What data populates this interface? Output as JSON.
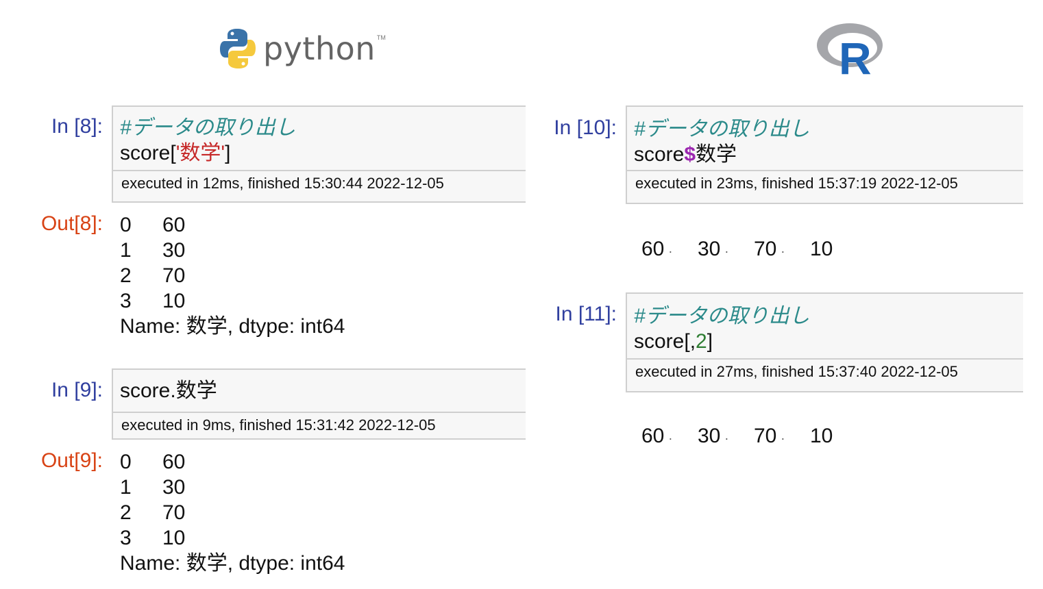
{
  "logos": {
    "python_word": "python",
    "python_tm": "TM",
    "r_letter": "R"
  },
  "left": {
    "cell1": {
      "prompt_in": "In [8]:",
      "comment": "#データの取り出し",
      "code_prefix": "score[",
      "code_string": "'数学'",
      "code_suffix": "]",
      "exec": "executed in 12ms, finished 15:30:44 2022-12-05",
      "prompt_out": "Out[8]:",
      "rows": [
        [
          "0",
          "60"
        ],
        [
          "1",
          "30"
        ],
        [
          "2",
          "70"
        ],
        [
          "3",
          "10"
        ]
      ],
      "footer": "Name: 数学, dtype: int64"
    },
    "cell2": {
      "prompt_in": "In [9]:",
      "code": "score.数学",
      "exec": "executed in 9ms, finished 15:31:42 2022-12-05",
      "prompt_out": "Out[9]:",
      "rows": [
        [
          "0",
          "60"
        ],
        [
          "1",
          "30"
        ],
        [
          "2",
          "70"
        ],
        [
          "3",
          "10"
        ]
      ],
      "footer": "Name: 数学, dtype: int64"
    }
  },
  "right": {
    "cell1": {
      "prompt_in": "In [10]:",
      "comment": "#データの取り出し",
      "code_prefix": "score",
      "code_dollar": "$",
      "code_suffix": "数学",
      "exec": "executed in 23ms, finished 15:37:19 2022-12-05",
      "values": [
        "60",
        "30",
        "70",
        "10"
      ]
    },
    "cell2": {
      "prompt_in": "In [11]:",
      "comment": "#データの取り出し",
      "code_prefix": "score[,",
      "code_num": "2",
      "code_suffix": "]",
      "exec": "executed in 27ms, finished 15:37:40 2022-12-05",
      "values": [
        "60",
        "30",
        "70",
        "10"
      ]
    }
  },
  "colors": {
    "prompt_in": "#303f9f",
    "prompt_out": "#d84315",
    "comment": "#2b8a8a",
    "string": "#c62828",
    "number": "#2e7d32",
    "dollar": "#9c27b0"
  }
}
